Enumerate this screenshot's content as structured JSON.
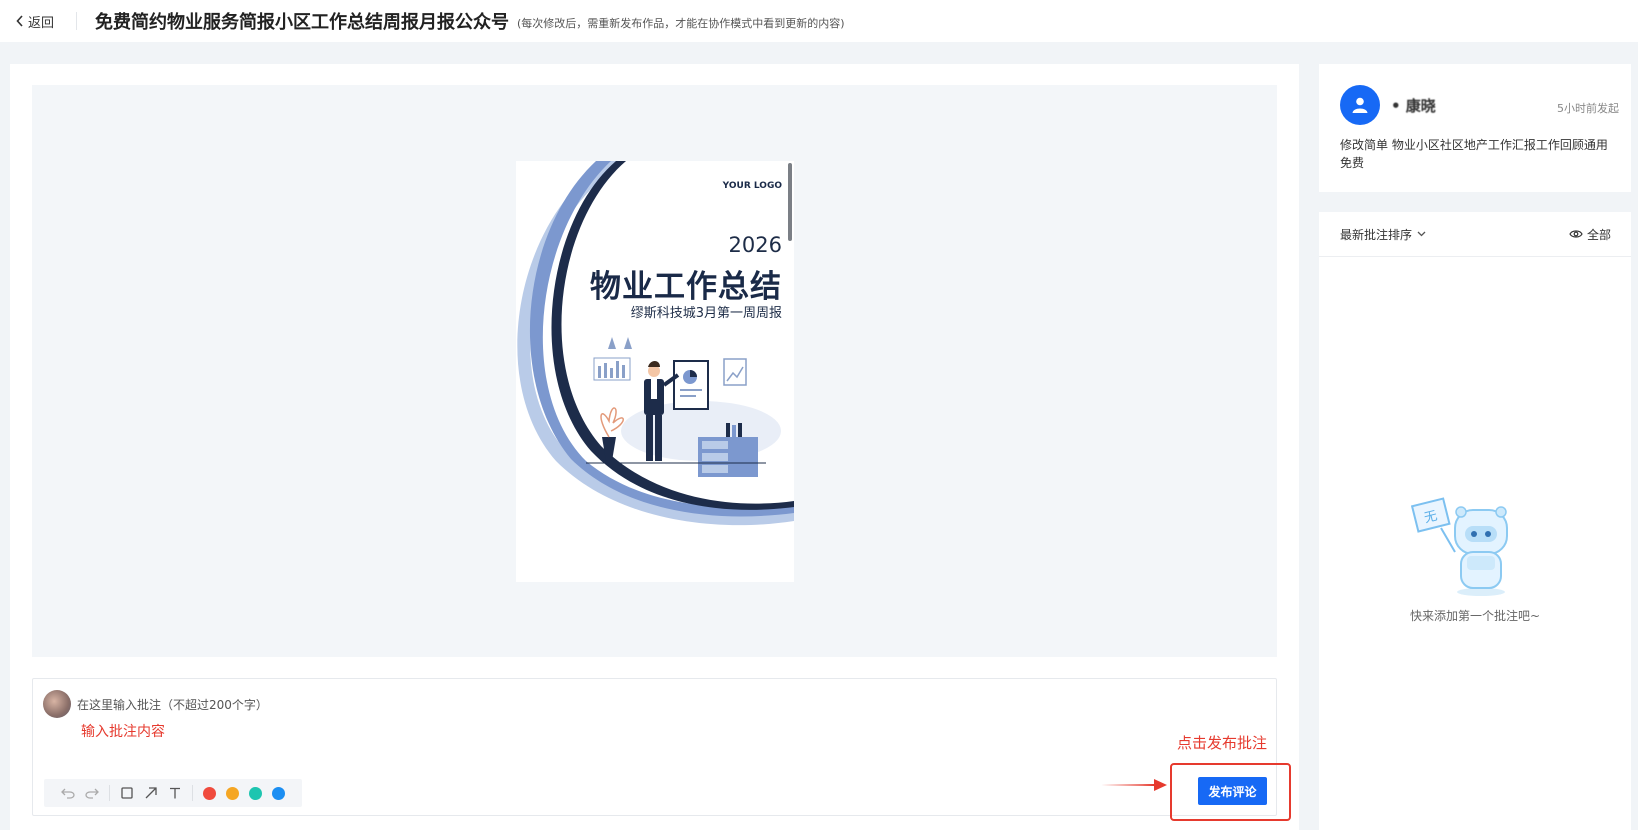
{
  "topbar": {
    "back_label": "返回",
    "title": "免费简约物业服务简报小区工作总结周报月报公众号",
    "note": "(每次修改后，需重新发布作品，才能在协作模式中看到更新的内容)"
  },
  "poster": {
    "logo_text": "YOUR LOGO",
    "year": "2026",
    "heading": "物业工作总结",
    "subheading": "缪斯科技城3月第一周周报"
  },
  "comment": {
    "placeholder": "在这里输入批注（不超过200个字）",
    "hint": "输入批注内容",
    "colors": [
      "#f04b3e",
      "#f5a623",
      "#1dc5b0",
      "#1b8ef2"
    ],
    "publish_label": "发布评论",
    "click_hint": "点击发布批注"
  },
  "user": {
    "name": "• 康晓",
    "time": "5小时前发起",
    "description": "修改简单 物业小区社区地产工作汇报工作回顾通用免费"
  },
  "notes": {
    "sort_label": "最新批注排序",
    "view_label": "全部",
    "empty_text": "快来添加第一个批注吧~",
    "mascot_sign": "无"
  }
}
